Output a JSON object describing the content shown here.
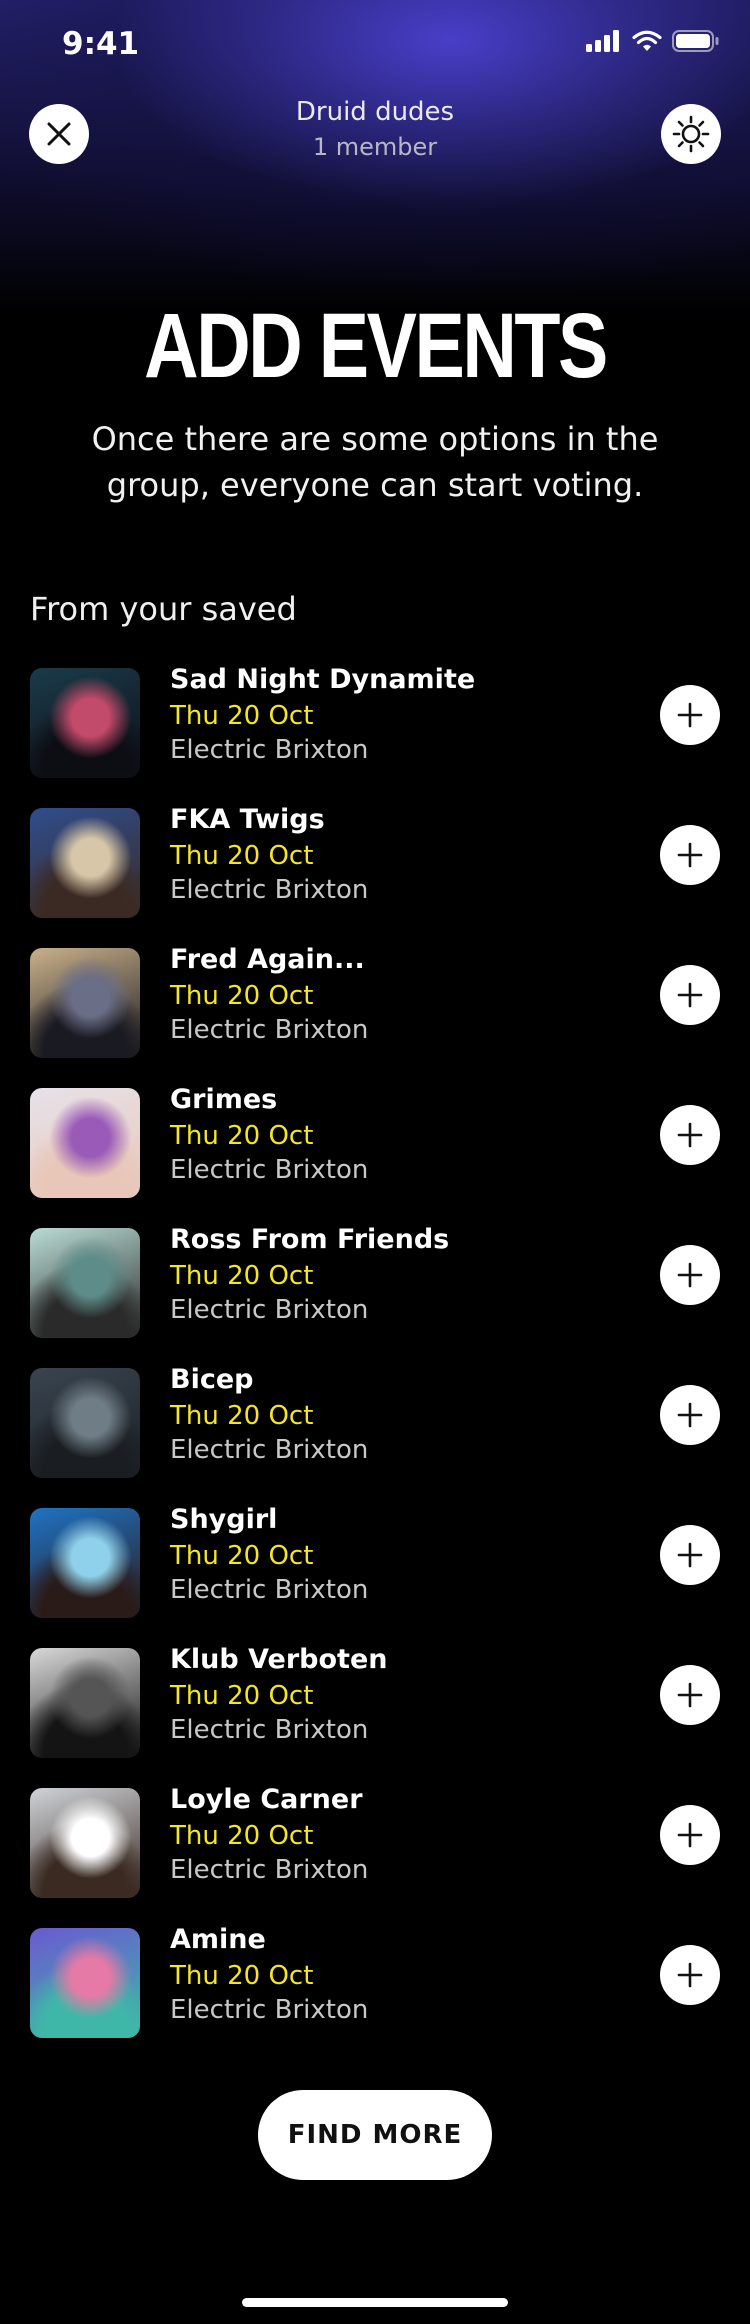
{
  "status_bar": {
    "time": "9:41",
    "icons": [
      "signal-icon",
      "wifi-icon",
      "battery-icon"
    ]
  },
  "header": {
    "group_name": "Druid dudes",
    "member_count": "1 member",
    "close_icon": "close-icon",
    "settings_icon": "gear-icon"
  },
  "main": {
    "title": "ADD EVENTS",
    "subtitle": "Once there are some options in the group, everyone can start voting.",
    "section_label": "From your saved"
  },
  "events": [
    {
      "name": "Sad Night Dynamite",
      "date": "Thu 20 Oct",
      "venue": "Electric Brixton",
      "thumb_colors": [
        "#1b3b4a",
        "#c24a6a",
        "#0d0d14"
      ]
    },
    {
      "name": "FKA Twigs",
      "date": "Thu 20 Oct",
      "venue": "Electric Brixton",
      "thumb_colors": [
        "#2f4d8c",
        "#d7c7a8",
        "#3b2a24"
      ]
    },
    {
      "name": "Fred Again...",
      "date": "Thu 20 Oct",
      "venue": "Electric Brixton",
      "thumb_colors": [
        "#c9b08a",
        "#6a6e86",
        "#1a1a22"
      ]
    },
    {
      "name": "Grimes",
      "date": "Thu 20 Oct",
      "venue": "Electric Brixton",
      "thumb_colors": [
        "#e7e2ea",
        "#9a5ab8",
        "#e8c7b8"
      ]
    },
    {
      "name": "Ross From Friends",
      "date": "Thu 20 Oct",
      "venue": "Electric Brixton",
      "thumb_colors": [
        "#b9dcd4",
        "#5e8c88",
        "#2a2a2a"
      ]
    },
    {
      "name": "Bicep",
      "date": "Thu 20 Oct",
      "venue": "Electric Brixton",
      "thumb_colors": [
        "#3a4550",
        "#6f7d86",
        "#1a1e22"
      ]
    },
    {
      "name": "Shygirl",
      "date": "Thu 20 Oct",
      "venue": "Electric Brixton",
      "thumb_colors": [
        "#1f73c4",
        "#8fd0ea",
        "#2a1a18"
      ]
    },
    {
      "name": "Klub Verboten",
      "date": "Thu 20 Oct",
      "venue": "Electric Brixton",
      "thumb_colors": [
        "#d9d9d9",
        "#555555",
        "#141414"
      ]
    },
    {
      "name": "Loyle Carner",
      "date": "Thu 20 Oct",
      "venue": "Electric Brixton",
      "thumb_colors": [
        "#cfd3d8",
        "#ffffff",
        "#3a2a22"
      ]
    },
    {
      "name": "Amine",
      "date": "Thu 20 Oct",
      "venue": "Electric Brixton",
      "thumb_colors": [
        "#6a5ad0",
        "#e67aa6",
        "#3fb7a8"
      ]
    }
  ],
  "find_more_label": "FIND MORE",
  "colors": {
    "accent_date": "#f2e52a",
    "button_bg": "#ffffff",
    "background": "#000000",
    "glow": "#4a40ce"
  }
}
